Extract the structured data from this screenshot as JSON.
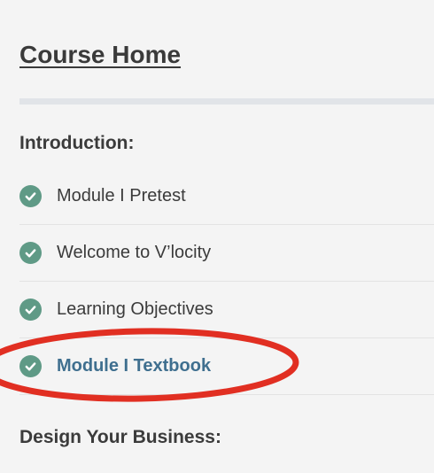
{
  "header": {
    "title": "Course Home"
  },
  "sections": [
    {
      "heading": "Introduction:",
      "items": [
        {
          "label": "Module I Pretest",
          "icon": "check-circle-icon",
          "completed": true,
          "active": false
        },
        {
          "label": "Welcome to V’locity",
          "icon": "check-circle-icon",
          "completed": true,
          "active": false
        },
        {
          "label": "Learning Objectives",
          "icon": "check-circle-icon",
          "completed": true,
          "active": false
        },
        {
          "label": "Module I Textbook",
          "icon": "check-circle-icon",
          "completed": true,
          "active": true
        }
      ]
    },
    {
      "heading": "Design Your Business:"
    }
  ],
  "colors": {
    "background": "#f4f4f4",
    "check": "#5f9a86",
    "active_link": "#3f6f8f",
    "annotation": "#e12f22"
  }
}
